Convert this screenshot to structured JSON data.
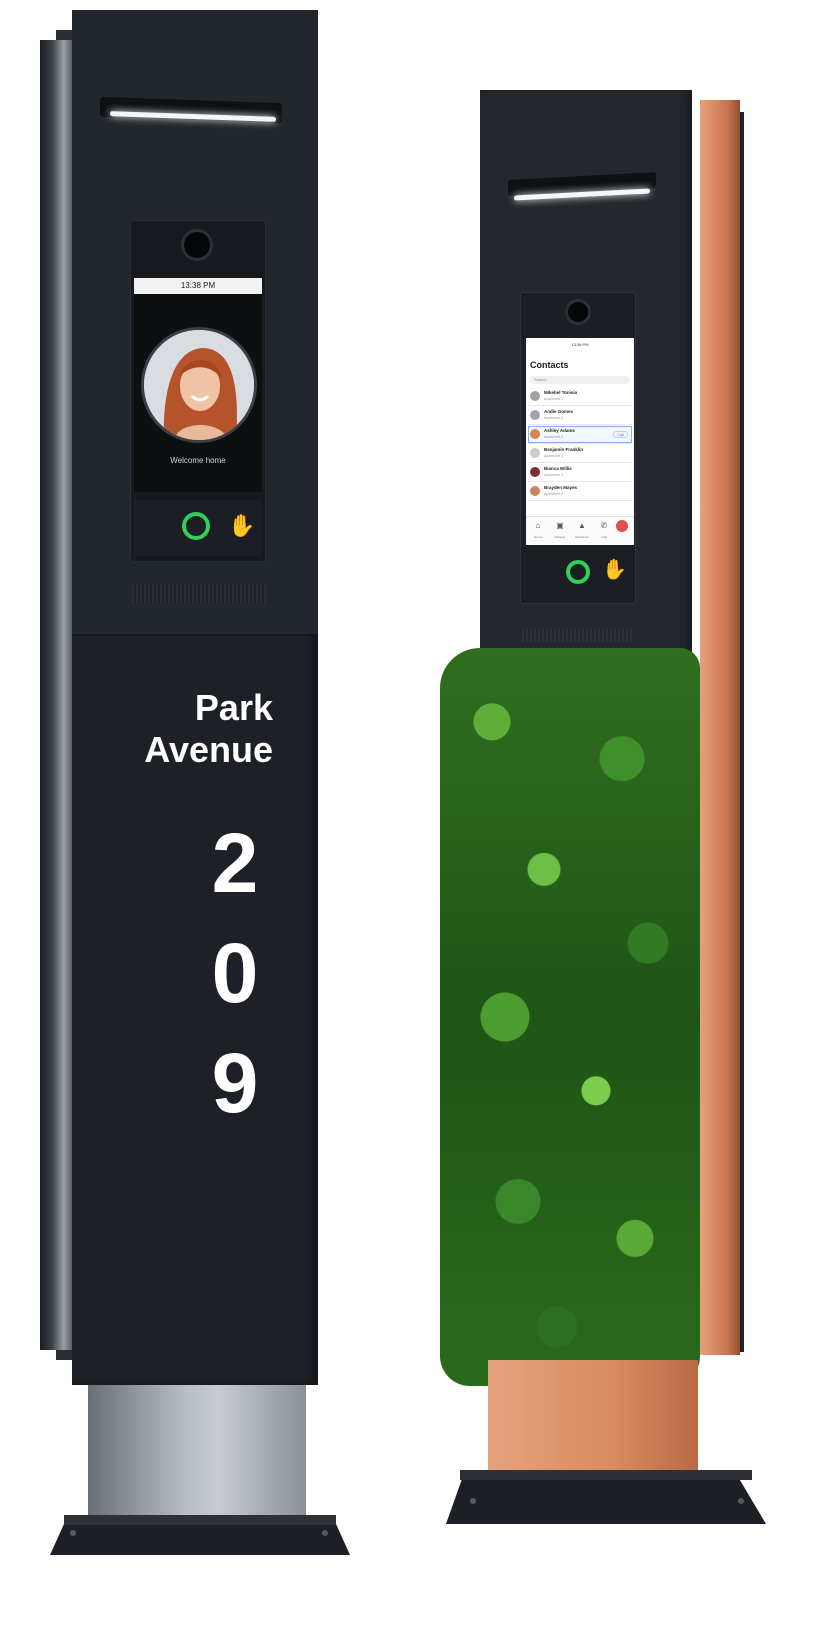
{
  "left_pillar": {
    "screen_time": "13:38 PM",
    "welcome_text": "Welcome home",
    "street_line1": "Park",
    "street_line2": "Avenue",
    "digits": [
      "2",
      "0",
      "9"
    ],
    "colors": {
      "panel": "#1d2127",
      "ring": "#2ed15a",
      "stem": "#b9bec5"
    },
    "icons": {
      "gesture": "hand-wave-icon",
      "ring": "status-ring-icon"
    }
  },
  "right_pillar": {
    "screen_time": "13:38 PM",
    "title": "Contacts",
    "search_placeholder": "Search",
    "contacts": [
      {
        "name": "Mikebel Tonisia",
        "sub": "Apartment 1"
      },
      {
        "name": "Andie Gomes",
        "sub": "Apartment 2"
      },
      {
        "name": "Ashley Adams",
        "sub": "Apartment 3",
        "selected": true,
        "action": "Call"
      },
      {
        "name": "Benjamin Franklin",
        "sub": "Apartment 4"
      },
      {
        "name": "Bianca Willis",
        "sub": "Apartment 5"
      },
      {
        "name": "Brayden Mayes",
        "sub": "Apartment 6"
      }
    ],
    "nav": [
      {
        "icon": "home-icon",
        "glyph": "⌂",
        "label": "Home"
      },
      {
        "icon": "package-icon",
        "glyph": "▣",
        "label": "Delivery"
      },
      {
        "icon": "building-icon",
        "glyph": "▲",
        "label": "Residents"
      },
      {
        "icon": "phone-icon",
        "glyph": "✆",
        "label": "Call"
      }
    ],
    "colors": {
      "planter": "#d98a60",
      "foliage": "#3f8f2a",
      "ring": "#2ed15a"
    },
    "icons": {
      "gesture": "hand-wave-icon",
      "ring": "status-ring-icon"
    }
  }
}
